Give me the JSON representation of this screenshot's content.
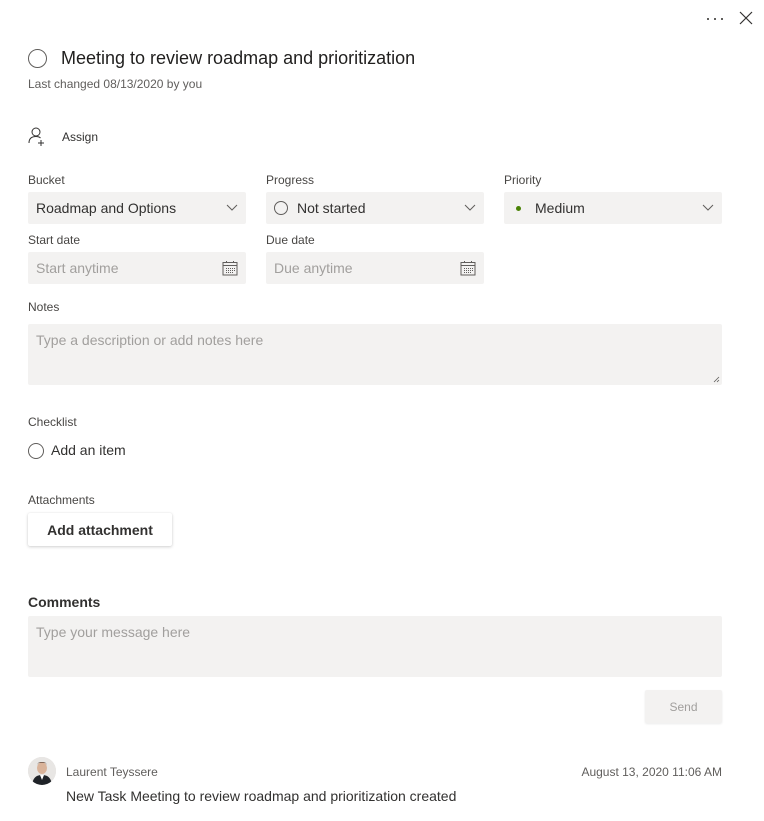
{
  "header": {
    "more_icon": "more-horizontal-icon",
    "close_icon": "close-icon"
  },
  "task": {
    "title": "Meeting to review roadmap and prioritization",
    "last_changed": "Last changed 08/13/2020 by you",
    "complete_icon": "circle-icon"
  },
  "assign": {
    "label": "Assign",
    "icon": "add-person-icon"
  },
  "fields": {
    "bucket": {
      "label": "Bucket",
      "value": "Roadmap and Options"
    },
    "progress": {
      "label": "Progress",
      "value": "Not started"
    },
    "priority": {
      "label": "Priority",
      "value": "Medium",
      "dot_color": "#498205"
    },
    "start_date": {
      "label": "Start date",
      "placeholder": "Start anytime"
    },
    "due_date": {
      "label": "Due date",
      "placeholder": "Due anytime"
    }
  },
  "notes": {
    "label": "Notes",
    "placeholder": "Type a description or add notes here"
  },
  "checklist": {
    "label": "Checklist",
    "add_placeholder": "Add an item"
  },
  "attachments": {
    "label": "Attachments",
    "button": "Add attachment"
  },
  "comments": {
    "label": "Comments",
    "placeholder": "Type your message here",
    "send": "Send",
    "items": [
      {
        "author": "Laurent Teyssere",
        "timestamp": "August 13, 2020 11:06 AM",
        "text": "New Task Meeting to review roadmap and prioritization created"
      }
    ]
  }
}
